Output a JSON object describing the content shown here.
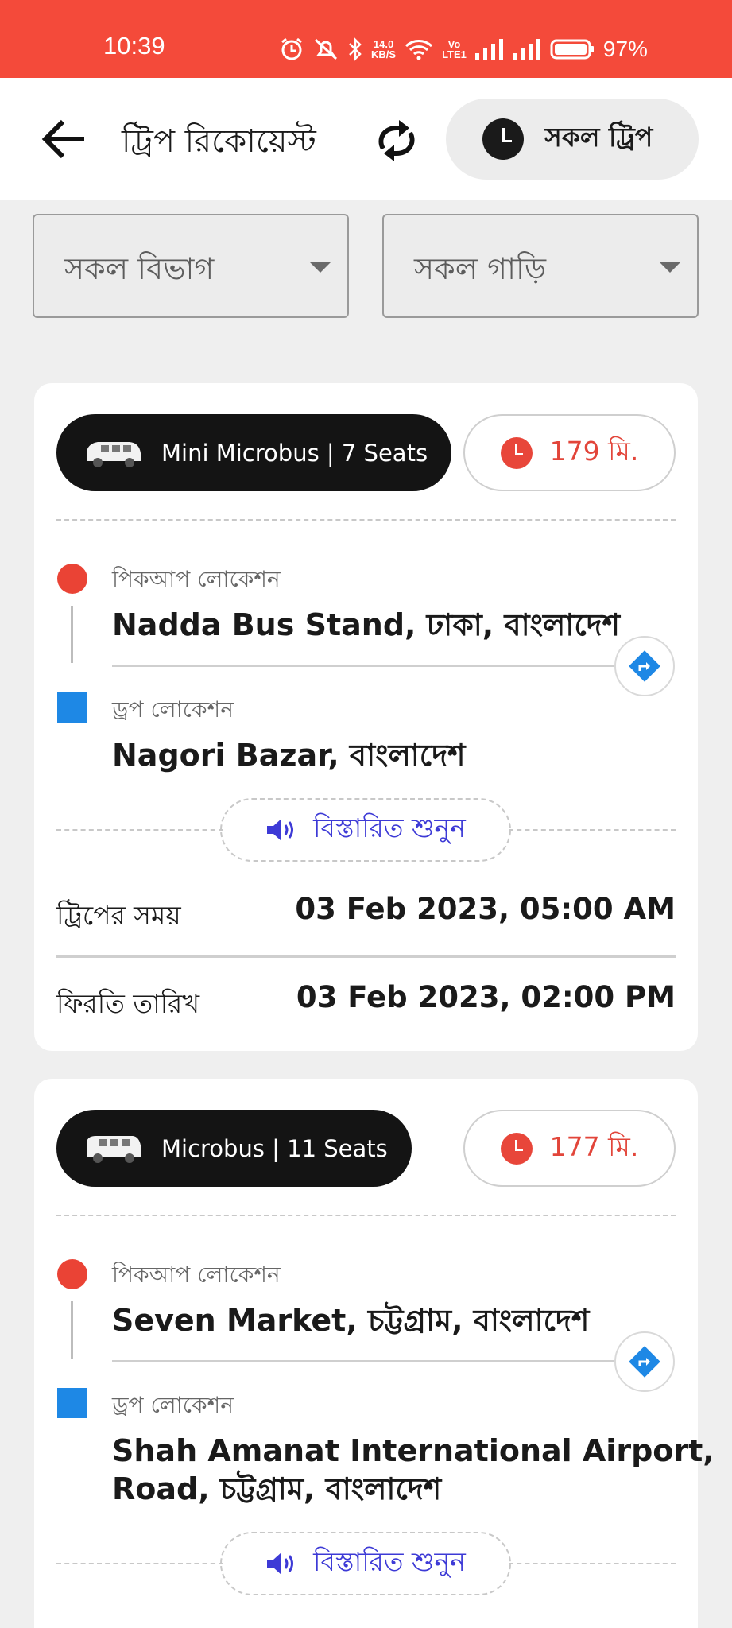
{
  "status_bar": {
    "time": "10:39",
    "net_speed_value": "14.0",
    "net_speed_unit": "KB/S",
    "volte_top": "Vo",
    "volte_bottom": "LTE1",
    "battery_percent": "97%"
  },
  "header": {
    "title": "ট্রিপ রিকোয়েস্ট",
    "all_trips_label": "সকল ট্রিপ"
  },
  "filters": {
    "division": "সকল বিভাগ",
    "vehicle": "সকল গাড়ি"
  },
  "trips": [
    {
      "vehicle": "Mini Microbus | 7 Seats",
      "eta": "179 মি.",
      "pickup_caption": "পিকআপ লোকেশন",
      "pickup": "Nadda Bus Stand, ঢাকা, বাংলাদেশ",
      "drop_caption": "ড্রপ লোকেশন",
      "drop_line1": "Nagori Bazar, বাংলাদেশ",
      "listen_label": "বিস্তারিত শুনুন",
      "trip_time_label": "ট্রিপের সময়",
      "trip_time": "03 Feb 2023, 05:00 AM",
      "return_label": "ফিরতি তারিখ",
      "return_time": "03 Feb 2023, 02:00 PM"
    },
    {
      "vehicle": "Microbus | 11 Seats",
      "eta": "177 মি.",
      "pickup_caption": "পিকআপ লোকেশন",
      "pickup": "Seven Market, চট্টগ্রাম, বাংলাদেশ",
      "drop_caption": "ড্রপ লোকেশন",
      "drop_line1": "Shah Amanat International Airport,",
      "drop_line2": "Road, চট্টগ্রাম, বাংলাদেশ",
      "listen_label": "বিস্তারিত শুনুন"
    }
  ],
  "colors": {
    "status_bar": "#f44a3a",
    "accent_red": "#e2453a",
    "pickup_dot": "#ea4335",
    "drop_square": "#1e88e5",
    "listen_text": "#3d3ad6"
  },
  "icons": {
    "back": "arrow-left-icon",
    "refresh": "refresh-icon",
    "clock": "clock-icon",
    "dropdown": "caret-down-icon",
    "vehicle": "van-icon",
    "navigate": "directions-icon",
    "speaker": "speaker-icon"
  }
}
